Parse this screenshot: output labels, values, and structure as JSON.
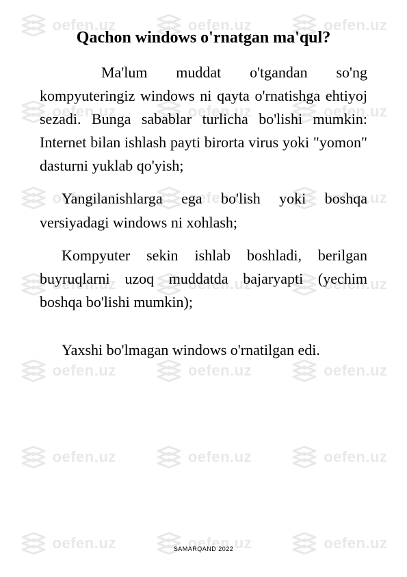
{
  "watermark": {
    "text": "oefen.uz",
    "icon_name": "stacked-layers-icon"
  },
  "title": "Qachon windows o'rnatgan ma'qul?",
  "paragraphs": {
    "p1": "Ma'lum muddat o'tgandan so'ng kompyuteringiz windows ni qayta o'rnatishga ehtiyoj sezadi. Bunga sabablar turlicha bo'lishi mumkin: Internet bilan ishlash payti birorta virus yoki \"yomon\" dasturni yuklab qo'yish;",
    "p2": "Yangilanishlarga ega bo'lish yoki boshqa versiyadagi windows ni xohlash;",
    "p3": "Kompyuter sekin ishlab boshladi, berilgan buyruqlarni uzoq muddatda bajaryapti (yechim boshqa bo'lishi mumkin);",
    "p4": "Yaxshi bo'lmagan windows o'rnatilgan edi."
  },
  "footer": "SAMARQAND 2022"
}
